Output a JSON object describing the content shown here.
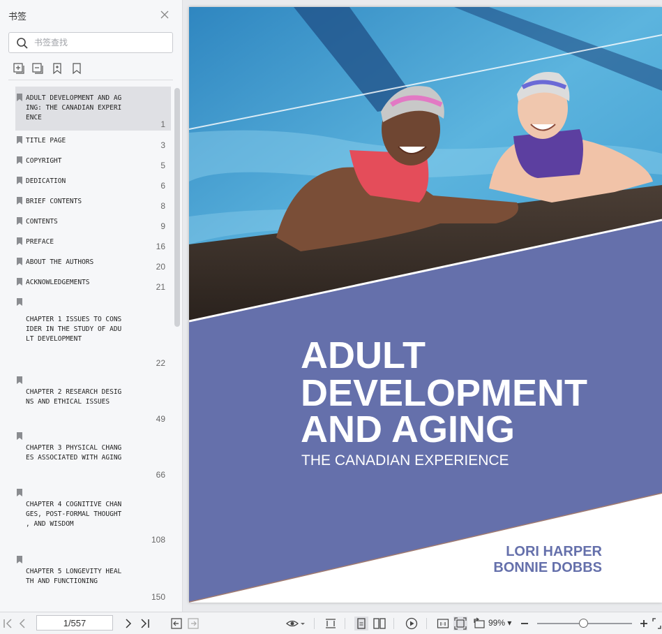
{
  "sidebar": {
    "title": "书签",
    "search_placeholder": "书签查找",
    "items": [
      {
        "label": "ADULT DEVELOPMENT AND AG\nING: THE CANADIAN EXPERI\nENCE",
        "page": "1",
        "selected": true
      },
      {
        "label": "TITLE PAGE",
        "page": "3"
      },
      {
        "label": "COPYRIGHT",
        "page": "5"
      },
      {
        "label": "DEDICATION",
        "page": "6"
      },
      {
        "label": "BRIEF CONTENTS",
        "page": "8"
      },
      {
        "label": "CONTENTS",
        "page": "9"
      },
      {
        "label": "PREFACE",
        "page": "16"
      },
      {
        "label": "ABOUT THE AUTHORS",
        "page": "20"
      },
      {
        "label": "ACKNOWLEDGEMENTS",
        "page": "21"
      },
      {
        "label": "CHAPTER 1 ISSUES TO CONS\nIDER IN THE STUDY OF ADU\nLT DEVELOPMENT",
        "page": "22"
      },
      {
        "label": "CHAPTER 2 RESEARCH DESIG\nNS AND ETHICAL ISSUES",
        "page": "49"
      },
      {
        "label": "CHAPTER 3 PHYSICAL CHANG\nES ASSOCIATED WITH AGING",
        "page": "66"
      },
      {
        "label": "CHAPTER 4 COGNITIVE CHAN\nGES, POST-FORMAL THOUGHT\n, AND WISDOM",
        "page": "108"
      },
      {
        "label": "CHAPTER 5 LONGEVITY HEAL\nTH AND FUNCTIONING",
        "page": "150"
      }
    ]
  },
  "cover": {
    "title_lines": [
      "ADULT",
      "DEVELOPMENT",
      "AND AGING"
    ],
    "subtitle": "THE CANADIAN EXPERIENCE",
    "authors": [
      "LORI HARPER",
      "BONNIE DOBBS"
    ],
    "colors": {
      "band": "#6570ab",
      "water": "#3d94c8",
      "deck": "#3a2f28",
      "stripe": "#a07a70"
    }
  },
  "toolbar": {
    "page_value": "1/557",
    "zoom": "99%"
  }
}
